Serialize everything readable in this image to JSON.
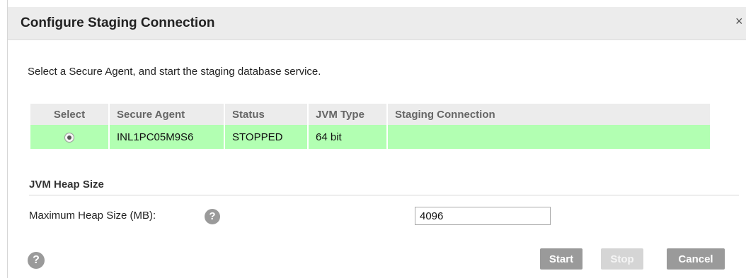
{
  "dialog": {
    "title": "Configure Staging Connection",
    "close_glyph": "×",
    "instruction": "Select a Secure Agent, and start the staging database service."
  },
  "table": {
    "headers": [
      "Select",
      "Secure Agent",
      "Status",
      "JVM Type",
      "Staging Connection"
    ],
    "rows": [
      {
        "selected": true,
        "secure_agent": "INL1PC05M9S6",
        "status": "STOPPED",
        "jvm_type": "64 bit",
        "staging_connection": ""
      }
    ]
  },
  "heap": {
    "section_title": "JVM Heap Size",
    "label": "Maximum Heap Size (MB):",
    "value": "4096",
    "help_glyph": "?"
  },
  "footer": {
    "help_glyph": "?",
    "start_label": "Start",
    "stop_label": "Stop",
    "cancel_label": "Cancel"
  },
  "colors": {
    "header_bg": "#ececec",
    "selected_row_bg": "#b2ffb2",
    "button_bg": "#9a9a9a",
    "button_disabled_bg": "#d5d5d5"
  },
  "icons": {
    "close": "close-icon",
    "help": "help-icon",
    "radio": "radio-selected-icon"
  }
}
